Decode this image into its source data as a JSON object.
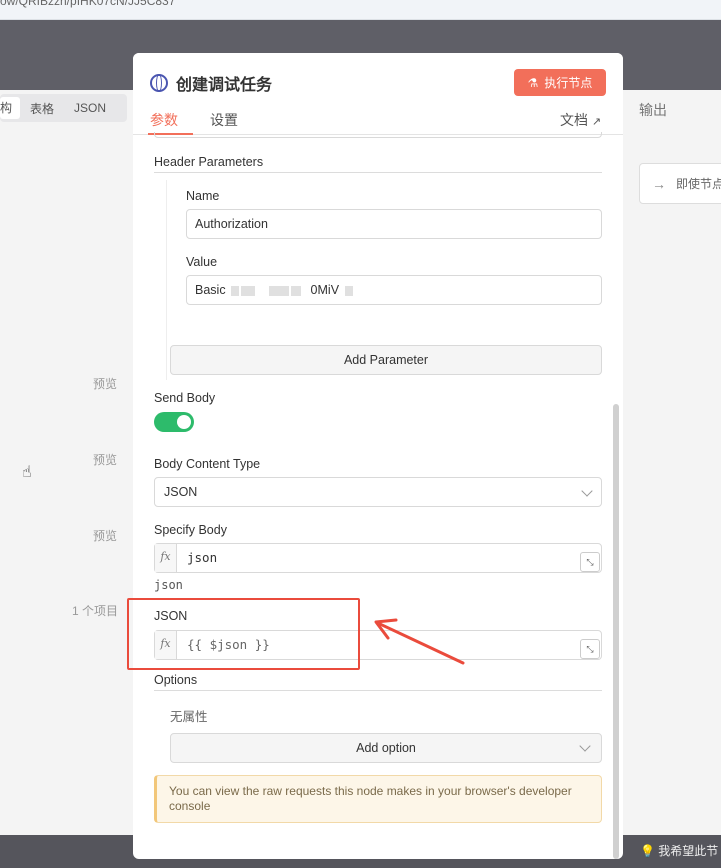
{
  "url_fragment": "ow/QRIBzzh/pIHK07cN/JJ5C837",
  "left_tabs": [
    "构",
    "表格",
    "JSON"
  ],
  "left_previews": [
    "预览",
    "预览",
    "预览"
  ],
  "left_items_count": "1 个项目",
  "right": {
    "output_title": "输出",
    "exec_prev_label": "即使节点"
  },
  "footer_feedback": "我希望此节",
  "modal": {
    "title": "创建调试任务",
    "exec_button": "执行节点",
    "tabs": [
      "参数",
      "设置"
    ],
    "docs_link": "文档",
    "header_parameters_label": "Header Parameters",
    "name_label": "Name",
    "name_value": "Authorization",
    "value_label": "Value",
    "value_prefix": "Basic",
    "value_suffix": "0MiV",
    "add_parameter": "Add Parameter",
    "send_body_label": "Send Body",
    "body_content_type_label": "Body Content Type",
    "body_content_type_value": "JSON",
    "specify_body_label": "Specify Body",
    "fx_tag": "fx",
    "specify_body_value": "json",
    "specify_body_hint": "json",
    "json_label": "JSON",
    "json_value": "{{ $json }}",
    "options_label": "Options",
    "no_properties": "无属性",
    "add_option": "Add option",
    "note": "You can view the raw requests this node makes in your browser's developer console"
  },
  "colors": {
    "accent": "#f26f5a",
    "toggle_on": "#2dbb6b",
    "annotation": "#ea4b3c"
  }
}
